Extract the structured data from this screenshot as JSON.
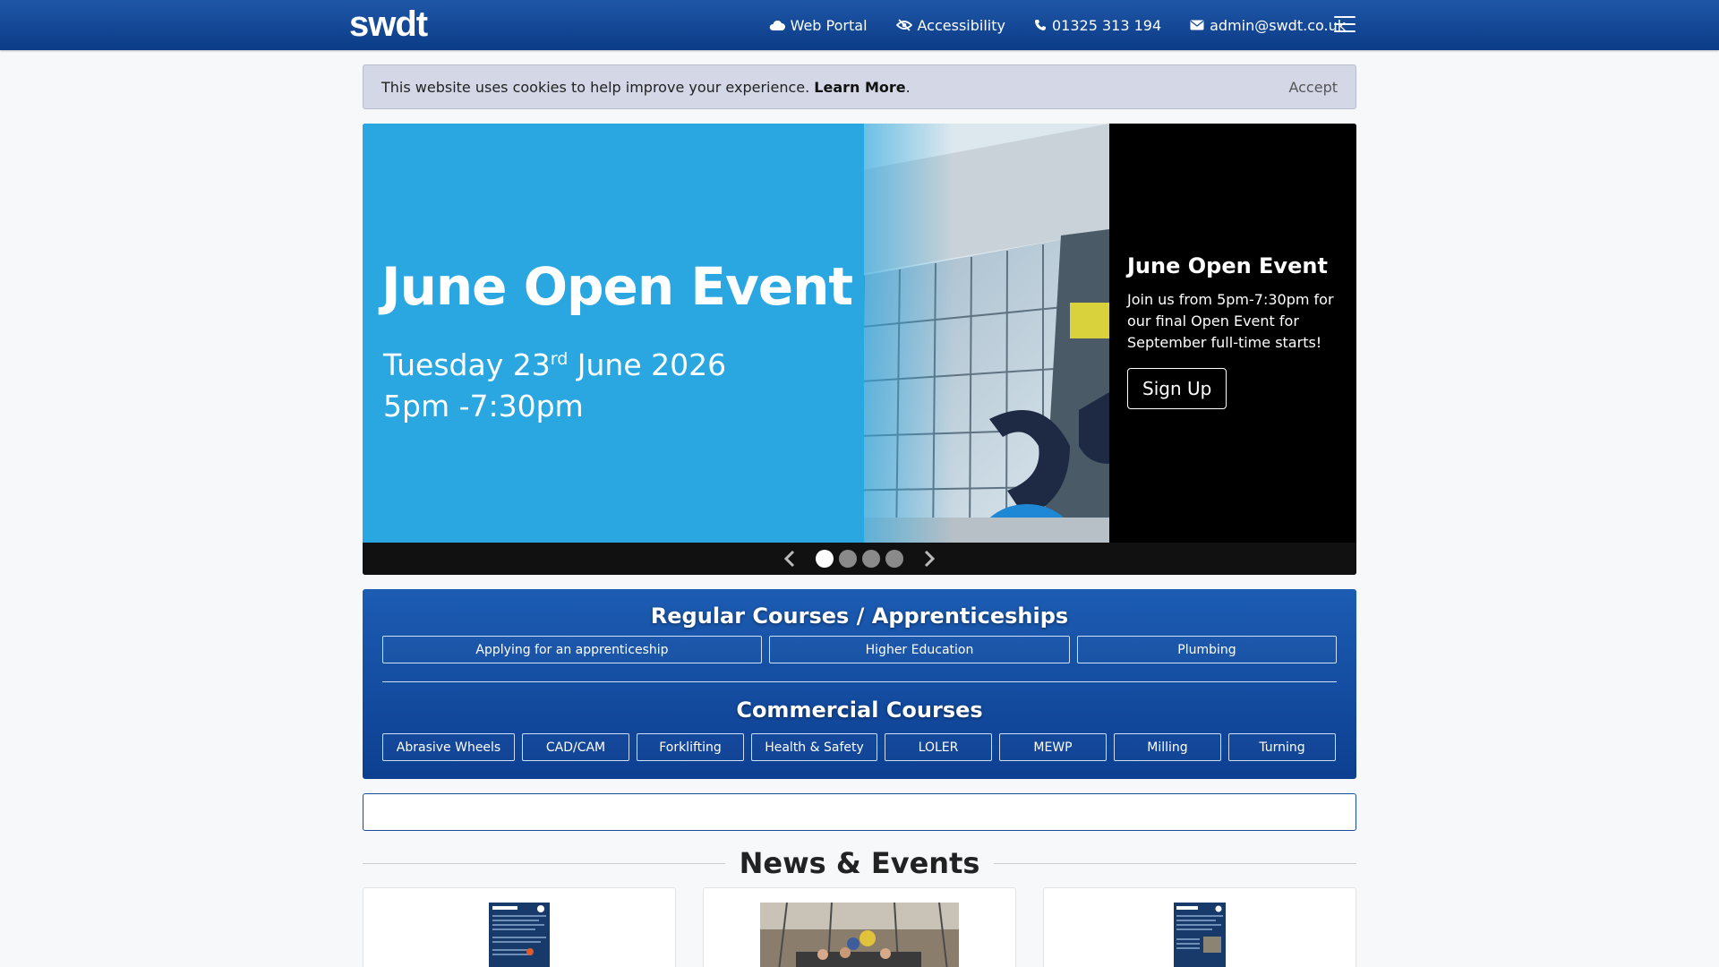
{
  "header": {
    "logo": "swdt",
    "links": [
      {
        "label": "Web Portal",
        "icon": "cloud-icon"
      },
      {
        "label": "Accessibility",
        "icon": "eye-slash-icon"
      },
      {
        "label": "01325 313 194",
        "icon": "phone-icon"
      },
      {
        "label": "admin@swdt.co.uk",
        "icon": "envelope-icon"
      }
    ],
    "menu_icon": "hamburger-menu-icon"
  },
  "cookie_banner": {
    "text": "This website uses cookies to help improve your experience.",
    "learn_more": "Learn More",
    "period": ".",
    "accept": "Accept"
  },
  "carousel": {
    "slide": {
      "title": "June Open Event",
      "date_day": "Tuesday 23",
      "date_suffix": "rd",
      "date_rest": " June 2026",
      "time": "5pm -7:30pm"
    },
    "caption": {
      "title": "June Open Event",
      "text": "Join us from 5pm-7:30pm for our final Open Event for September full-time starts!",
      "button": "Sign Up"
    },
    "slide_count": 4,
    "active_slide": 1
  },
  "courses": {
    "regular_heading": "Regular Courses / Apprenticeships",
    "regular": [
      "Applying for an apprenticeship",
      "Higher Education",
      "Plumbing"
    ],
    "commercial_heading": "Commercial Courses",
    "commercial": [
      "Abrasive Wheels",
      "CAD/CAM",
      "Forklifting",
      "Health & Safety",
      "LOLER",
      "MEWP",
      "Milling",
      "Turning"
    ]
  },
  "news": {
    "heading": "News & Events"
  },
  "colors": {
    "navbar": "#0b3b86",
    "courses_panel": "#1c5cb3",
    "slide_blue": "#2aa7e1"
  }
}
